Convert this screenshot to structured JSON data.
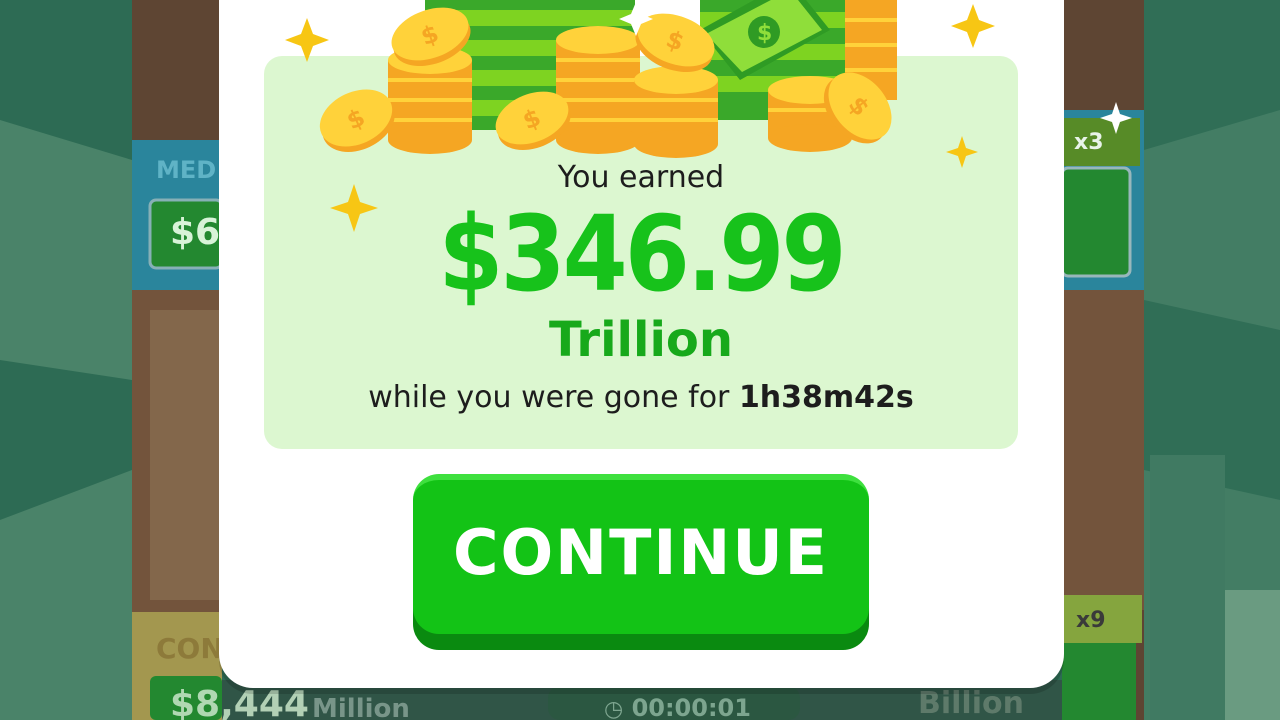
{
  "popup": {
    "earned_label": "You earned",
    "amount": "$346.99",
    "unit": "Trillion",
    "away_prefix": "while you were gone for ",
    "away_duration": "1h38m42s",
    "continue_label": "CONTINUE"
  },
  "background": {
    "left_card_top_label": "MED",
    "left_card_top_value": "$6",
    "left_card_bottom_label": "CON",
    "left_card_bottom_value": "$8,444",
    "left_card_bottom_unit": "Million",
    "timer": "00:00:01",
    "right_card_top_badge": "x3",
    "right_card_bottom_badge": "x9",
    "right_card_bottom_unit": "Billion"
  },
  "colors": {
    "accent_green": "#13c316",
    "amount_green": "#17c21b",
    "panel_bg": "#dcf7d0"
  },
  "icons": [
    "sparkle-icon",
    "coin-icon",
    "cash-stack-icon",
    "timer-icon"
  ]
}
